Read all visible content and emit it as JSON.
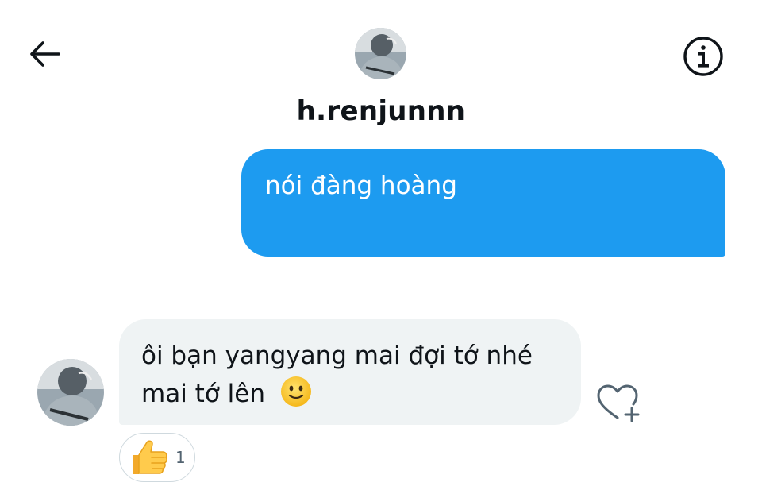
{
  "header": {
    "username": "h.renjunnn",
    "back_icon": "arrow-left-icon",
    "info_icon": "info-icon"
  },
  "messages": {
    "sent": {
      "text": "nói đàng hoàng"
    },
    "received": {
      "line1": "ôi bạn yangyang mai đợi tớ nhé",
      "line2": "mai tớ lên",
      "emoji": "slightly-smiling-face-icon"
    }
  },
  "reactions": {
    "thumbs_up_count": "1",
    "add_reaction_icon": "heart-plus-icon"
  },
  "colors": {
    "accent": "#1d9bf0",
    "received_bubble": "#eff3f4",
    "text": "#0f1419"
  }
}
